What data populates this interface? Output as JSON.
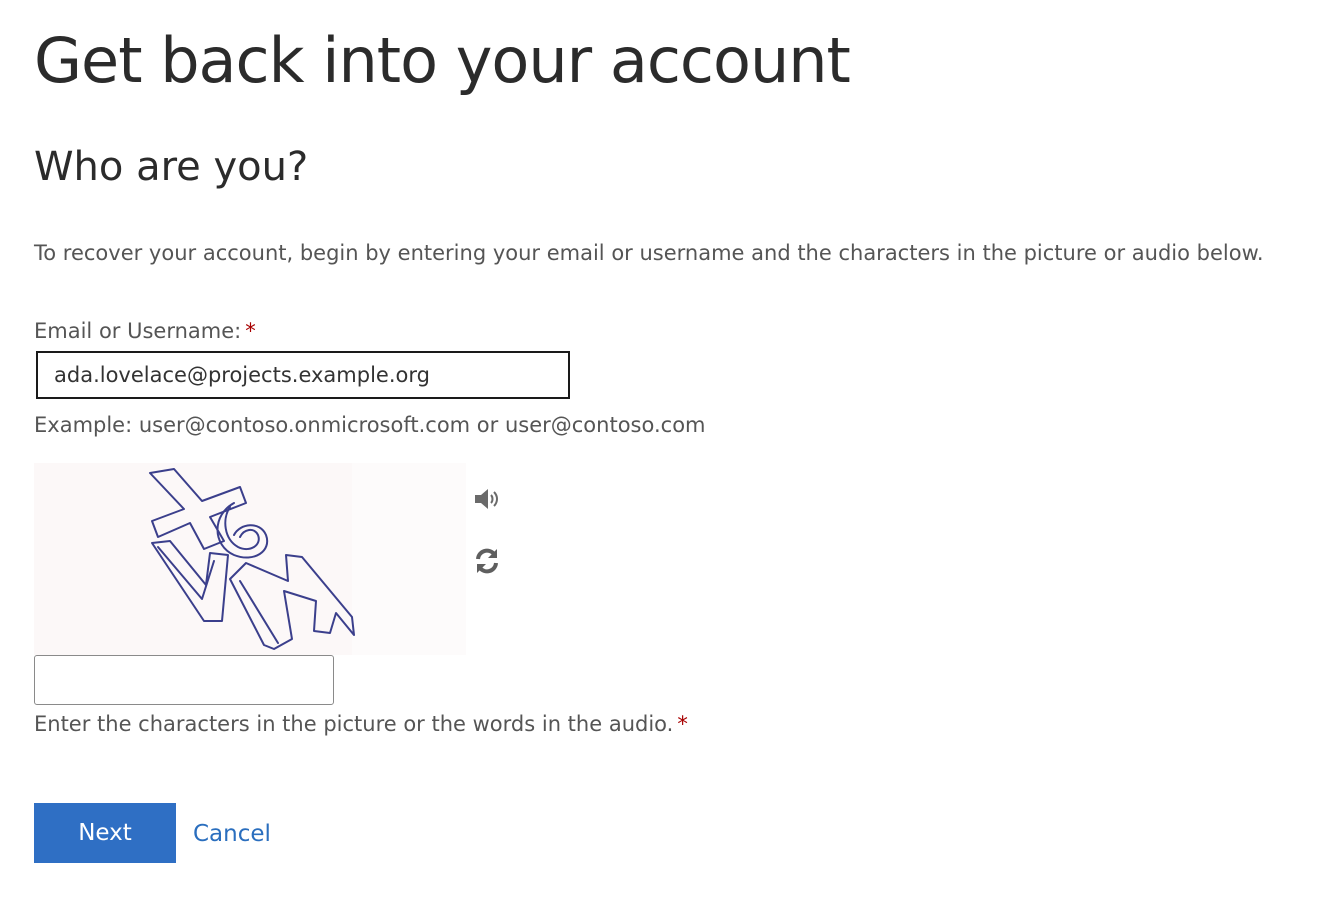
{
  "page": {
    "title": "Get back into your account",
    "section_title": "Who are you?",
    "instructions": "To recover your account, begin by entering your email or username and the characters in the picture or audio below."
  },
  "email_field": {
    "label": "Email or Username:",
    "required_marker": "*",
    "value": "ada.lovelace@projects.example.org",
    "example": "Example: user@contoso.onmicrosoft.com or user@contoso.com"
  },
  "captcha": {
    "image_text": "Y6VM",
    "audio_icon": "speaker-icon",
    "refresh_icon": "refresh-icon",
    "input_value": "",
    "hint": "Enter the characters in the picture or the words in the audio.",
    "required_marker": "*"
  },
  "actions": {
    "next_label": "Next",
    "cancel_label": "Cancel"
  },
  "colors": {
    "primary_button": "#2f6fc4",
    "link": "#2a6ebe",
    "required": "#a80000",
    "text": "#555555",
    "heading": "#2b2b2b"
  }
}
